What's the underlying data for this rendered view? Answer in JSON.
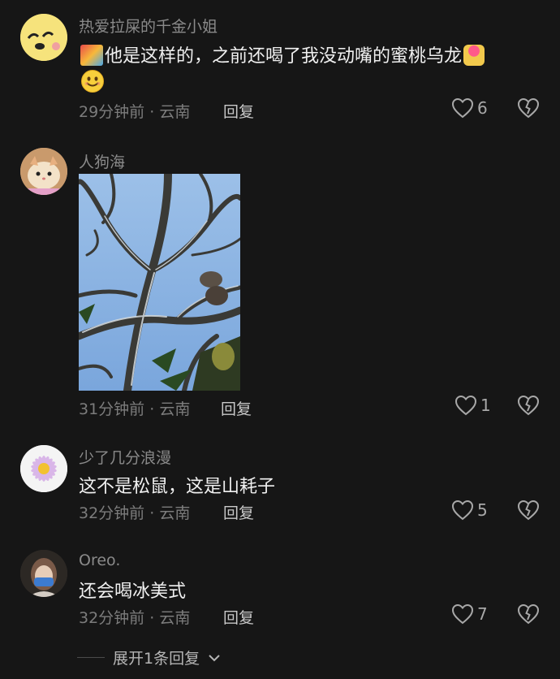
{
  "comments": [
    {
      "username": "热爱拉屎的千金小姐",
      "text": "他是这样的，之前还喝了我没动嘴的蜜桃乌龙",
      "time": "29分钟前",
      "location": "云南",
      "reply_label": "回复",
      "likes": "6"
    },
    {
      "username": "人狗海",
      "text": "",
      "time": "31分钟前",
      "location": "云南",
      "reply_label": "回复",
      "likes": "1"
    },
    {
      "username": "少了几分浪漫",
      "text": "这不是松鼠，这是山耗子",
      "time": "32分钟前",
      "location": "云南",
      "reply_label": "回复",
      "likes": "5"
    },
    {
      "username": "Oreo.",
      "text": "还会喝冰美式",
      "time": "32分钟前",
      "location": "云南",
      "reply_label": "回复",
      "likes": "7"
    }
  ],
  "meta_separator": " · ",
  "expand": {
    "label": "展开1条回复"
  },
  "icons": {
    "like": "heart-outline-icon",
    "dislike": "broken-heart-icon",
    "expand": "chevron-down-icon"
  },
  "colors": {
    "background": "#161616",
    "username": "#8a8a8a",
    "text": "#f0f0f0",
    "meta": "#7c7c7c"
  }
}
